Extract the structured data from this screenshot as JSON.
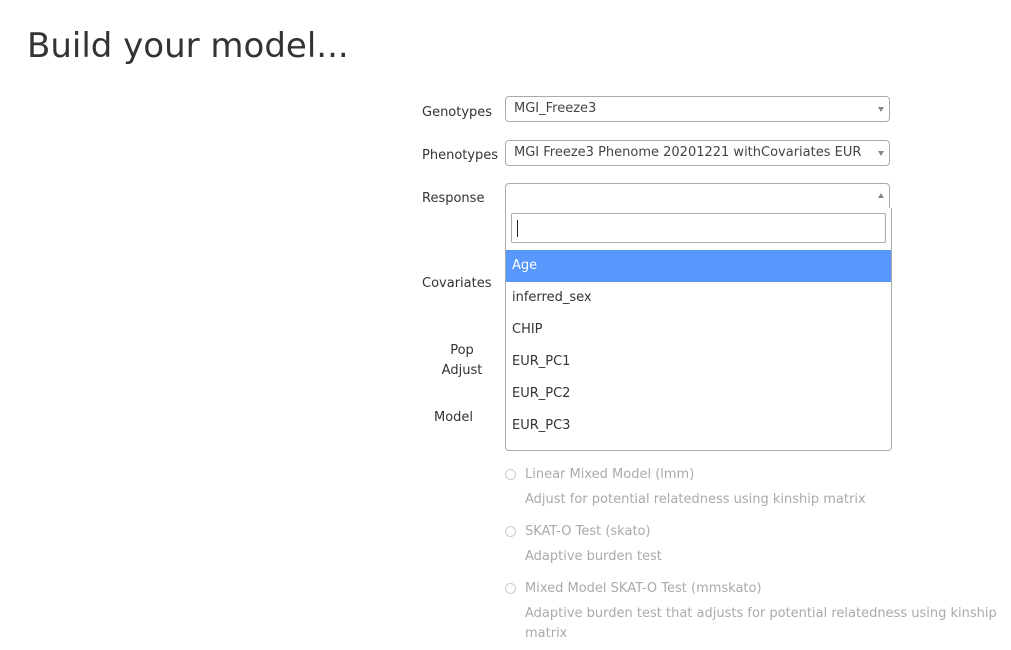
{
  "page": {
    "title": "Build your model..."
  },
  "form": {
    "genotypes": {
      "label": "Genotypes",
      "value": "MGI_Freeze3"
    },
    "phenotypes": {
      "label": "Phenotypes",
      "value": "MGI Freeze3 Phenome 20201221 withCovariates EUR"
    },
    "response": {
      "label": "Response",
      "value": "",
      "search_value": "",
      "options": [
        "Age",
        "inferred_sex",
        "CHIP",
        "EUR_PC1",
        "EUR_PC2",
        "EUR_PC3"
      ],
      "highlighted": "Age"
    },
    "covariates": {
      "label": "Covariates"
    },
    "pop_adjust": {
      "label_line1": "Pop",
      "label_line2": "Adjust"
    },
    "model": {
      "label": "Model",
      "options": [
        {
          "name": "Linear Mixed Model (lmm)",
          "description": "Adjust for potential relatedness using kinship matrix"
        },
        {
          "name": "SKAT-O Test (skato)",
          "description": "Adaptive burden test"
        },
        {
          "name": "Mixed Model SKAT-O Test (mmskato)",
          "description": "Adaptive burden test that adjusts for potential relatedness using kinship matrix"
        }
      ]
    }
  },
  "colors": {
    "highlight": "#5897fb",
    "disabled_text": "#aaaaaa",
    "border": "#aaaaaa"
  }
}
